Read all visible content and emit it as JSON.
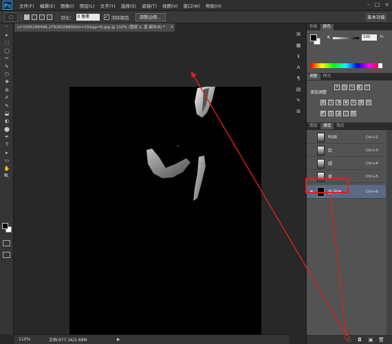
{
  "app": {
    "logo": "Ps"
  },
  "menu": [
    "文件(F)",
    "编辑(E)",
    "图像(I)",
    "图层(L)",
    "文字(Y)",
    "选择(S)",
    "滤镜(T)",
    "视图(V)",
    "窗口(W)",
    "帮助(H)"
  ],
  "window_controls": [
    "–",
    "□",
    "×"
  ],
  "options": {
    "tool_icon": "lasso-icon",
    "feather_label": "羽化：",
    "feather_value": "0 像素",
    "antialias_label": "消除锯齿",
    "refine_button": "调整边缘...",
    "workspace": "基本功能"
  },
  "tools": [
    "▸",
    "⬚",
    "◯",
    "✂",
    "✎",
    "⬡",
    "✚",
    "⊕",
    "✐",
    "✎",
    "⬓",
    "◐",
    "⬤",
    "✒",
    "T",
    "▸",
    "▭",
    "✋",
    "🔍"
  ],
  "document": {
    "tab_title": "u=1565296446,2791810880&fm=15&gp=0.jpg @ 110% (图层 1, 蓝 副本/8) *",
    "close": "×",
    "zoom": "110%",
    "doc_info": "文档:977.1K/2.68M",
    "status_arrow": "▶"
  },
  "panels": {
    "color_tabs": [
      "色板",
      "颜色"
    ],
    "color_active": 1,
    "k_label": "K",
    "k_value": "100",
    "k_unit": "%",
    "adj_tabs": [
      "调整",
      "样式"
    ],
    "adj_title": "添加调整",
    "channel_tabs": [
      "图层",
      "通道",
      "路径"
    ],
    "channel_active": 1,
    "channels": [
      {
        "name": "RGB",
        "shortcut": "Ctrl+2",
        "eye": "👁",
        "thumb": "light"
      },
      {
        "name": "红",
        "shortcut": "Ctrl+3",
        "eye": "",
        "thumb": "light"
      },
      {
        "name": "绿",
        "shortcut": "Ctrl+4",
        "eye": "",
        "thumb": "light"
      },
      {
        "name": "蓝",
        "shortcut": "Ctrl+5",
        "eye": "",
        "thumb": "light"
      },
      {
        "name": "蓝 副本",
        "shortcut": "Ctrl+6",
        "eye": "👁",
        "thumb": "dark",
        "selected": true
      }
    ],
    "bottom_icons": [
      "load-selection-icon",
      "save-selection-icon",
      "new-channel-icon",
      "trash-icon"
    ]
  },
  "annotation": {
    "color": "#e0201a"
  }
}
